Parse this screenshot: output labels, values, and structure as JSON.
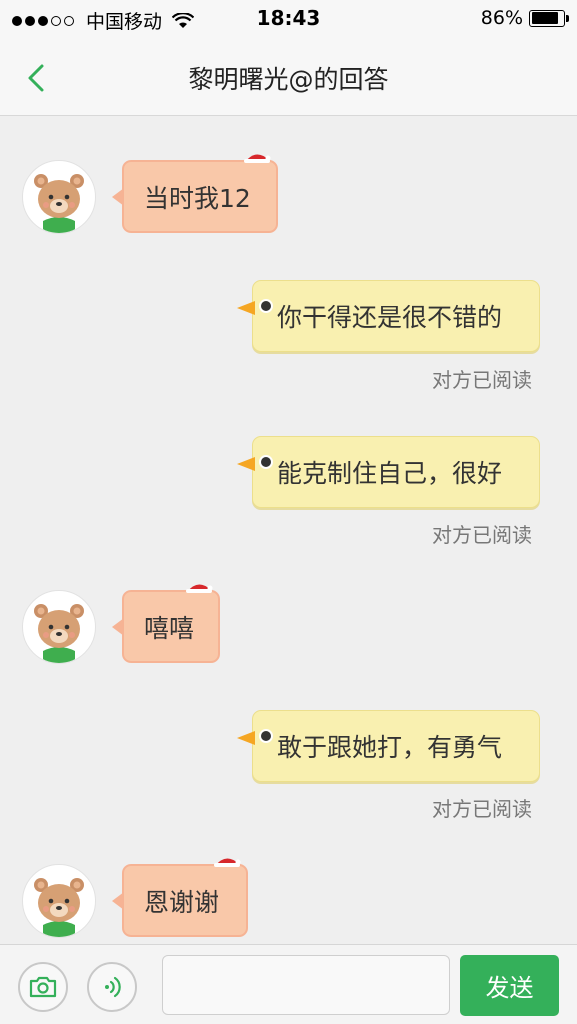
{
  "status_bar": {
    "carrier": "中国移动",
    "time": "18:43",
    "battery": "86%",
    "battery_level": 0.86
  },
  "nav": {
    "title": "黎明曙光@的回答",
    "back_icon": "chevron-left-icon"
  },
  "messages": [
    {
      "side": "in",
      "text": "当时我12"
    },
    {
      "side": "out",
      "text": "你干得还是很不错的",
      "read": "对方已阅读"
    },
    {
      "side": "out",
      "text": "能克制住自己，很好",
      "read": "对方已阅读"
    },
    {
      "side": "in",
      "text": "嘻嘻"
    },
    {
      "side": "out",
      "text": "敢于跟她打，有勇气",
      "read": "对方已阅读"
    },
    {
      "side": "in",
      "text": "恩谢谢"
    }
  ],
  "input_bar": {
    "camera_icon": "camera-icon",
    "voice_icon": "voice-icon",
    "input_value": "",
    "send_label": "发送"
  },
  "colors": {
    "accent": "#34b05a",
    "incoming_bubble": "#f9c8a9",
    "outgoing_bubble": "#f9f0b0"
  }
}
